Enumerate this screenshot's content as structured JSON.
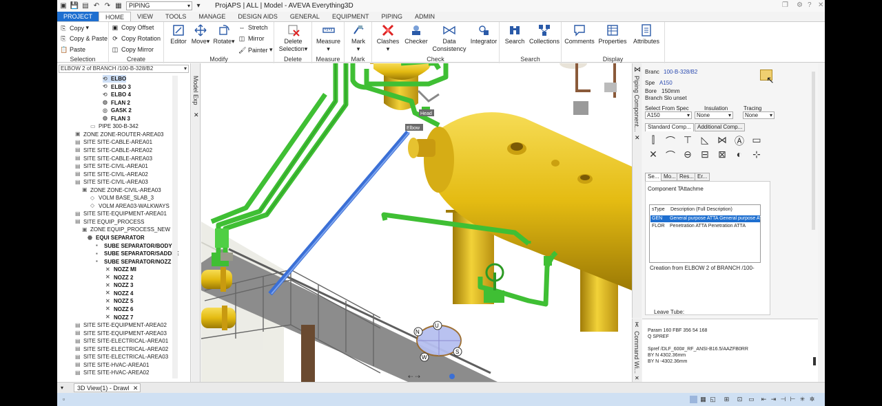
{
  "window": {
    "title": "ProjAPS | ALL | Model - AVEVA Everything3D",
    "module_combo": "PIPING"
  },
  "tabs": [
    "PROJECT",
    "HOME",
    "VIEW",
    "TOOLS",
    "MANAGE",
    "DESIGN AIDS",
    "GENERAL",
    "EQUIPMENT",
    "PIPING",
    "ADMIN"
  ],
  "ribbon": {
    "selection": {
      "label": "Selection",
      "copy": "Copy",
      "copy_paste": "Copy & Paste",
      "paste": "Paste"
    },
    "create": {
      "label": "Create",
      "copy_offset": "Copy Offset",
      "copy_rotation": "Copy Rotation",
      "copy_mirror": "Copy Mirror"
    },
    "modify": {
      "label": "Modify",
      "editor": "Editor",
      "move": "Move",
      "rotate": "Rotate",
      "stretch": "Stretch",
      "mirror": "Mirror",
      "painter": "Painter"
    },
    "delete": {
      "label": "Delete",
      "delete_selection": "Delete Selection"
    },
    "measure": {
      "label": "Measure",
      "measure": "Measure"
    },
    "mark": {
      "label": "Mark",
      "mark": "Mark"
    },
    "check": {
      "label": "Check",
      "clashes": "Clashes",
      "checker": "Checker",
      "data_consistency": "Data Consistency",
      "integrator": "Integrator"
    },
    "search": {
      "label": "Search",
      "search": "Search",
      "collections": "Collections"
    },
    "display": {
      "label": "Display",
      "comments": "Comments",
      "properties": "Properties",
      "attributes": "Attributes"
    }
  },
  "tree": {
    "header": "ELBOW 2 of BRANCH /100-B-328/B2",
    "panel_label": "Model Exp",
    "items": [
      {
        "text": "ELBO",
        "bold": true
      },
      {
        "text": "ELBO 3",
        "bold": true
      },
      {
        "text": "ELBO 4",
        "bold": true
      },
      {
        "text": "FLAN 2",
        "bold": true
      },
      {
        "text": "GASK 2",
        "bold": true
      },
      {
        "text": "FLAN 3",
        "bold": true
      },
      {
        "text": "PIPE 300-B-342",
        "bold": false
      },
      {
        "text": "ZONE ZONE-ROUTER-AREA03",
        "bold": false
      },
      {
        "text": "SITE SITE-CABLE-AREA01",
        "bold": false
      },
      {
        "text": "SITE SITE-CABLE-AREA02",
        "bold": false
      },
      {
        "text": "SITE SITE-CABLE-AREA03",
        "bold": false
      },
      {
        "text": "SITE SITE-CIVIL-AREA01",
        "bold": false
      },
      {
        "text": "SITE SITE-CIVIL-AREA02",
        "bold": false
      },
      {
        "text": "SITE SITE-CIVIL-AREA03",
        "bold": false
      },
      {
        "text": "ZONE ZONE-CIVIL-AREA03",
        "bold": false
      },
      {
        "text": "VOLM BASE_SLAB_3",
        "bold": false
      },
      {
        "text": "VOLM AREA03-WALKWAYS",
        "bold": false
      },
      {
        "text": "SITE SITE-EQUIPMENT-AREA01",
        "bold": false
      },
      {
        "text": "SITE EQUIP_PROCESS",
        "bold": false
      },
      {
        "text": "ZONE EQUIP_PROCESS_NEW",
        "bold": false
      },
      {
        "text": "EQUI SEPARATOR",
        "bold": true
      },
      {
        "text": "SUBE SEPARATOR/BODY",
        "bold": true
      },
      {
        "text": "SUBE SEPARATOR/SADDLE",
        "bold": true
      },
      {
        "text": "SUBE SEPARATOR/NOZZ",
        "bold": true
      },
      {
        "text": "NOZZ MI",
        "bold": true
      },
      {
        "text": "NOZZ 2",
        "bold": true
      },
      {
        "text": "NOZZ 3",
        "bold": true
      },
      {
        "text": "NOZZ 4",
        "bold": true
      },
      {
        "text": "NOZZ 5",
        "bold": true
      },
      {
        "text": "NOZZ 6",
        "bold": true
      },
      {
        "text": "NOZZ 7",
        "bold": true
      },
      {
        "text": "SITE SITE-EQUIPMENT-AREA02",
        "bold": false
      },
      {
        "text": "SITE SITE-EQUIPMENT-AREA03",
        "bold": false
      },
      {
        "text": "SITE SITE-ELECTRICAL-AREA01",
        "bold": false
      },
      {
        "text": "SITE SITE-ELECTRICAL-AREA02",
        "bold": false
      },
      {
        "text": "SITE SITE-ELECTRICAL-AREA03",
        "bold": false
      },
      {
        "text": "SITE SITE-HVAC-AREA01",
        "bold": false
      },
      {
        "text": "SITE SITE-HVAC-AREA02",
        "bold": false
      }
    ]
  },
  "viewport": {
    "head_label": "Head",
    "elbow_label": "Elbow",
    "compass": {
      "u": "U",
      "n": "N",
      "s": "S",
      "w": "W"
    }
  },
  "pipe_panel": {
    "vertical_label": "Piping Component...",
    "branch_label": "Branc",
    "branch_value": "100-B-328/B2",
    "spec_label": "Spe",
    "spec_value": "A150",
    "bore_label": "Bore",
    "bore_value": "150mm",
    "branch_slope_label": "Branch Slo",
    "branch_slope_value": "unset",
    "select_from_spec_label": "Select From Spec",
    "select_from_spec_value": "A150",
    "insulation_label": "Insulation",
    "insulation_value": "None",
    "tracing_label": "Tracing",
    "tracing_value": "None",
    "tab_standard": "Standard Comp...",
    "tab_additional": "Additional Comp...",
    "subtabs": [
      "Se...",
      "Mo...",
      "Res...",
      "Er..."
    ],
    "component_type_label": "Component T",
    "component_type_value": "Attachme",
    "table_headers": [
      "sType",
      "Description (Full Description)"
    ],
    "table_rows": [
      {
        "stype": "GEN",
        "desc": "General purpose ATTA General purpose ATT",
        "selected": true
      },
      {
        "stype": "FLOR",
        "desc": "Penetration ATTA Penetration ATTA",
        "selected": false
      }
    ],
    "creation_text": "Creation from ELBOW 2 of BRANCH /100-",
    "leave_tube_label": "Leave Tube:"
  },
  "command_window": {
    "label": "Command Wi...",
    "lines": [
      "Param 160 FBF 356 54 168",
      "Q SPREF",
      "",
      "Spref /DLF_600#_RF_ANSI-B16.5/AAZFB0RR",
      "BY N 4302.36mm",
      "BY N -4302.36mm"
    ]
  },
  "doc_tab": "3D View(1) - Drawl",
  "colors": {
    "accent": "#1e6fd0",
    "pipe_green": "#3fbf34",
    "pipe_blue": "#3a6fd6",
    "vessel_yellow": "#e8c21a",
    "status_bar": "#cfe0f3"
  }
}
